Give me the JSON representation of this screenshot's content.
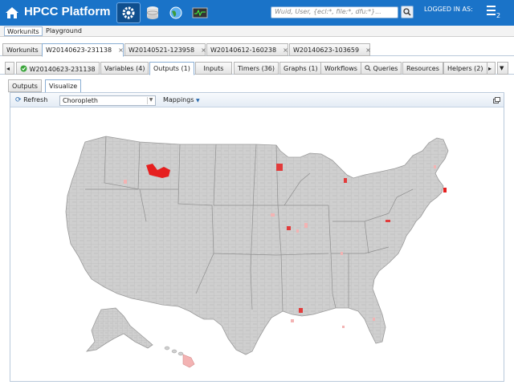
{
  "header": {
    "title": "HPCC Platform",
    "search_placeholder": "Wuid, User, {ecl:*, file:*, dfu:*}...",
    "logged_in_label": "LOGGED IN AS:",
    "menu_badge": "2"
  },
  "nav": {
    "workunits": "Workunits",
    "playground": "Playground"
  },
  "workunit_tabs": [
    {
      "label": "Workunits"
    },
    {
      "label": "W20140623-231138"
    },
    {
      "label": "W20140521-123958"
    },
    {
      "label": "W20140612-160238"
    },
    {
      "label": "W20140623-103659"
    }
  ],
  "detail_tabs": [
    {
      "label": "W20140623-231138"
    },
    {
      "label": "Variables (4)"
    },
    {
      "label": "Outputs (1)"
    },
    {
      "label": "Inputs"
    },
    {
      "label": "Timers (36)"
    },
    {
      "label": "Graphs (1)"
    },
    {
      "label": "Workflows"
    },
    {
      "label": "Queries"
    },
    {
      "label": "Resources"
    },
    {
      "label": "Helpers (2)"
    }
  ],
  "sub_tabs": [
    {
      "label": "Outputs"
    },
    {
      "label": "Visualize"
    }
  ],
  "toolbar": {
    "refresh": "Refresh",
    "viz_type": "Choropleth",
    "mappings": "Mappings"
  },
  "colors": {
    "header_bg": "#1a73c8",
    "map_fill": "#cfcfcf",
    "map_stroke": "#a9a9a9",
    "highlight": "#e61f1f",
    "light_highlight": "#f3b3b3"
  }
}
